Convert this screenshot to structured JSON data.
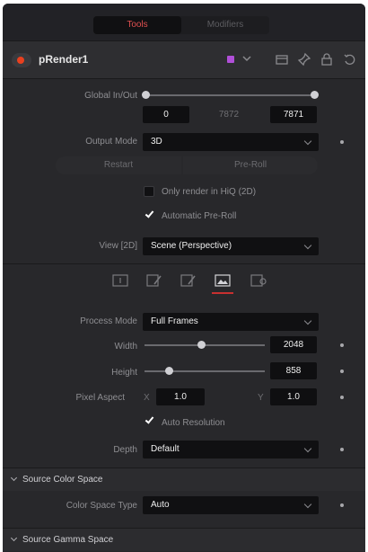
{
  "tabs": [
    {
      "label": "Tools",
      "active": true
    },
    {
      "label": "Modifiers",
      "active": false
    }
  ],
  "node": {
    "name": "pRender1",
    "color": "#b04fd8",
    "header_icons": [
      "version-icon",
      "pin-icon",
      "lock-icon",
      "reset-icon"
    ]
  },
  "global_in_out": {
    "label": "Global In/Out",
    "start": "0",
    "middle": "7872",
    "end": "7871"
  },
  "output_mode": {
    "label": "Output Mode",
    "value": "3D"
  },
  "buttons": {
    "restart": "Restart",
    "pre_roll": "Pre-Roll"
  },
  "checkboxes": {
    "hiq": {
      "label": "Only render in HiQ (2D)",
      "checked": false
    },
    "auto_preroll": {
      "label": "Automatic Pre-Roll",
      "checked": true
    }
  },
  "view": {
    "label": "View [2D]",
    "value": "Scene (Perspective)"
  },
  "subtabs": [
    "controls-icon",
    "edit-icon",
    "edit-alt-icon",
    "image-icon",
    "settings-icon"
  ],
  "active_subtab": 3,
  "process_mode": {
    "label": "Process Mode",
    "value": "Full Frames"
  },
  "width": {
    "label": "Width",
    "value": "2048",
    "slider": 0.47
  },
  "height": {
    "label": "Height",
    "value": "858",
    "slider": 0.2
  },
  "pixel_aspect": {
    "label": "Pixel Aspect",
    "x_label": "X",
    "x": "1.0",
    "y_label": "Y",
    "y": "1.0"
  },
  "auto_resolution": {
    "label": "Auto Resolution",
    "checked": true
  },
  "depth": {
    "label": "Depth",
    "value": "Default"
  },
  "source_color_space": {
    "title": "Source Color Space",
    "type_label": "Color Space Type",
    "type_value": "Auto"
  },
  "source_gamma_space": {
    "title": "Source Gamma Space"
  }
}
